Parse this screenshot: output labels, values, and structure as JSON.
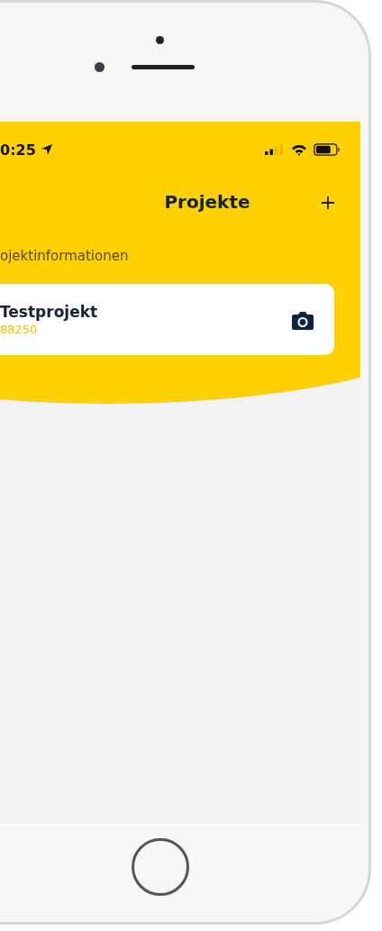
{
  "status_bar": {
    "time": "0:25"
  },
  "header": {
    "title": "Projekte"
  },
  "section_label": "ojektinformationen",
  "projects": [
    {
      "name": "Testprojekt",
      "number": "88250"
    }
  ]
}
